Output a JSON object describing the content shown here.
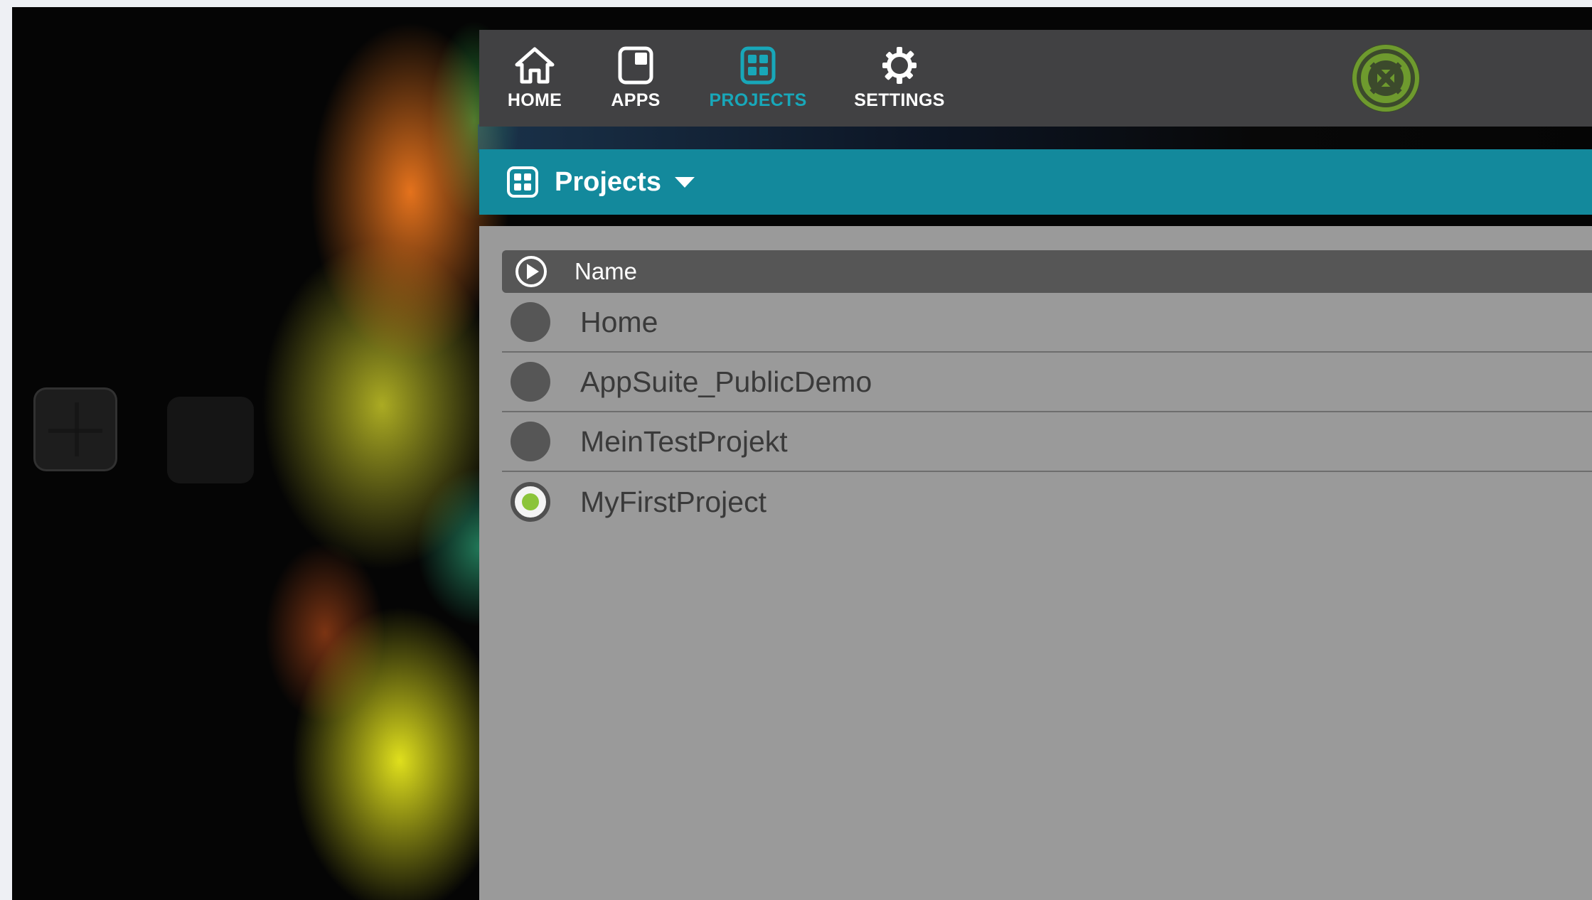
{
  "nav": {
    "items": [
      {
        "label": "HOME",
        "icon": "home-icon",
        "active": false
      },
      {
        "label": "APPS",
        "icon": "apps-icon",
        "active": false
      },
      {
        "label": "PROJECTS",
        "icon": "projects-icon",
        "active": true
      },
      {
        "label": "SETTINGS",
        "icon": "gear-icon",
        "active": false
      }
    ],
    "logo_icon": "logo-badge-icon"
  },
  "header": {
    "title": "Projects",
    "icon": "projects-icon",
    "caret_icon": "caret-down-icon"
  },
  "table": {
    "column_name": "Name",
    "rows": [
      {
        "label": "Home",
        "selected": false
      },
      {
        "label": "AppSuite_PublicDemo",
        "selected": false
      },
      {
        "label": "MeinTestProjekt",
        "selected": false
      },
      {
        "label": "MyFirstProject",
        "selected": true
      }
    ]
  },
  "colors": {
    "accent": "#18a7b9",
    "header_bar": "#13899c",
    "nav_bg": "#414143",
    "content_bg": "#9a9a9a",
    "selected_dot": "#8bc43a",
    "logo_green": "#6e9a2e"
  }
}
